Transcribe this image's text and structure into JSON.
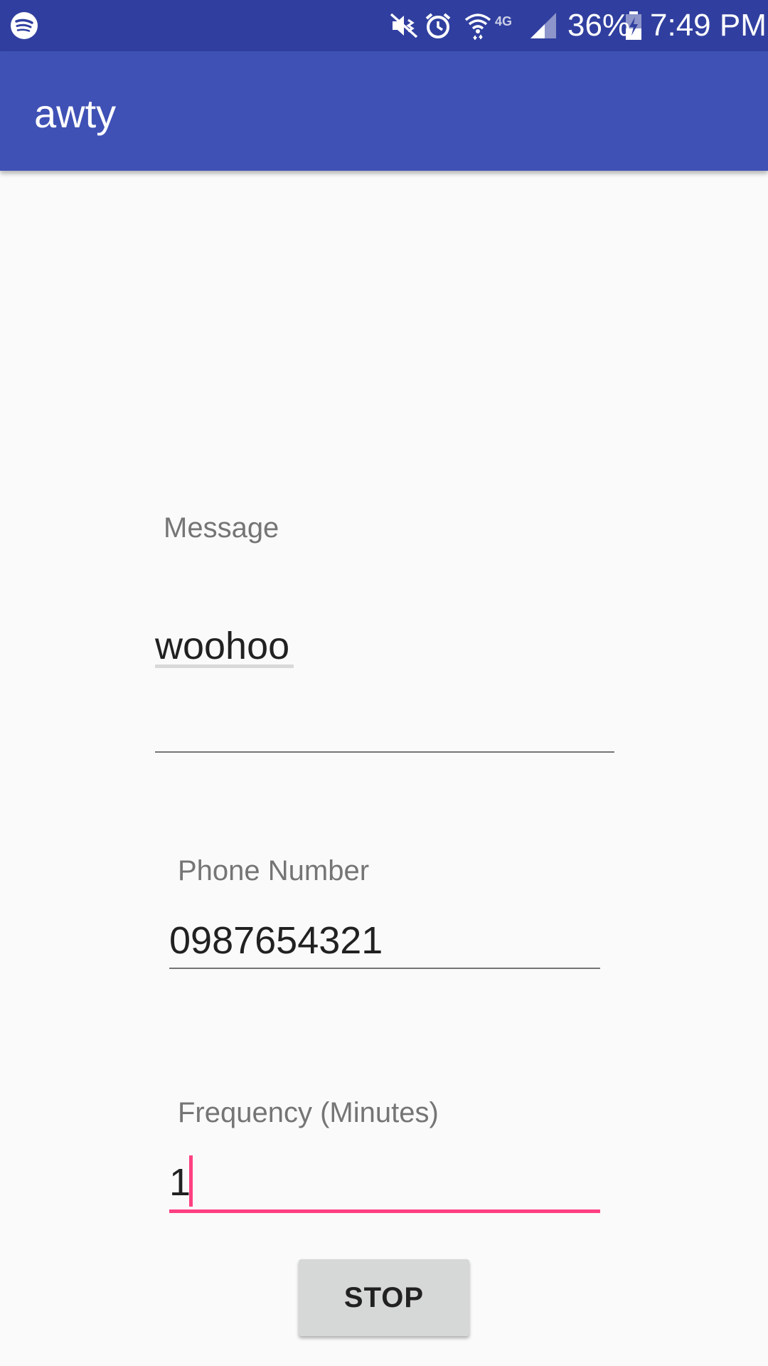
{
  "status_bar": {
    "battery": "36%",
    "time": "7:49 PM",
    "network": "4G",
    "icons": [
      "spotify-icon",
      "mute-vibrate-icon",
      "alarm-icon",
      "wifi-icon",
      "lte-icon",
      "signal-icon",
      "battery-charging-icon"
    ]
  },
  "app_bar": {
    "title": "awty"
  },
  "form": {
    "message": {
      "label": "Message",
      "value": "woohoo"
    },
    "phone": {
      "label": "Phone Number",
      "value": "0987654321"
    },
    "frequency": {
      "label": "Frequency (Minutes)",
      "value": "1"
    },
    "stop_button_label": "STOP"
  },
  "colors": {
    "status_bar": "#303f9f",
    "app_bar": "#3f51b5",
    "accent": "#ff4081",
    "background": "#fafafa",
    "button": "#d6d7d7"
  }
}
